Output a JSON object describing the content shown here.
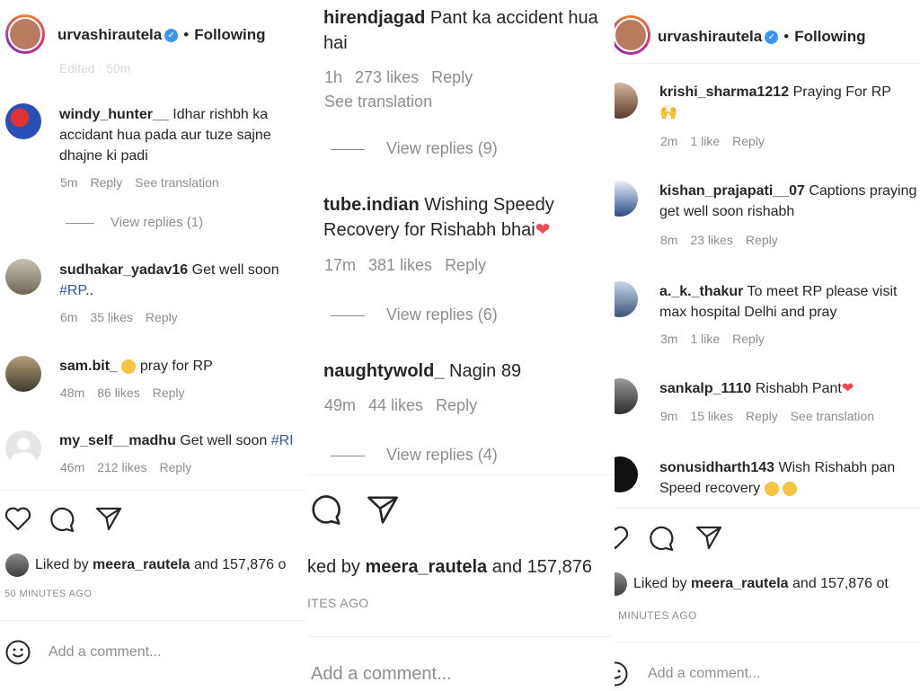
{
  "left": {
    "header": {
      "username": "urvashirautela",
      "following": "Following",
      "verified": "✓"
    },
    "truncated_top": "Edited · 50m",
    "comments": [
      {
        "user": "windy_hunter__",
        "text": "Idhar rishbh ka accidant hua pada aur tuze sajne dhajne ki padi",
        "time": "5m",
        "reply": "Reply",
        "extra": "See translation"
      },
      {
        "user": "sudhakar_yadav16",
        "text": "Get well soon",
        "tag": "#RP",
        "tail": "..",
        "time": "6m",
        "likes": "35 likes",
        "reply": "Reply"
      },
      {
        "user": "sam.bit_",
        "text": "pray for RP",
        "time": "48m",
        "likes": "86 likes",
        "reply": "Reply"
      },
      {
        "user": "my_self__madhu",
        "text": "Get well soon",
        "tag": "#RI",
        "time": "46m",
        "likes": "212 likes",
        "reply": "Reply"
      }
    ],
    "view_replies": "View replies (1)",
    "liked_prefix": "Liked by",
    "liked_user": "meera_rautela",
    "liked_suffix": "and 157,876 o",
    "time_ago": "50 MINUTES AGO",
    "add_comment": "Add a comment..."
  },
  "middle": {
    "comments": [
      {
        "user": "hirendjagad",
        "text": "Pant ka accident hua hai",
        "time": "1h",
        "likes": "273 likes",
        "reply": "Reply",
        "extra": "See translation",
        "replies": "View replies (9)"
      },
      {
        "user": "tube.indian",
        "text": "Wishing Speedy Recovery for Rishabh bhai",
        "time": "17m",
        "likes": "381 likes",
        "reply": "Reply",
        "replies": "View replies (6)"
      },
      {
        "user": "naughtywold_",
        "text": "Nagin 89",
        "time": "49m",
        "likes": "44 likes",
        "reply": "Reply",
        "replies": "View replies (4)"
      }
    ],
    "liked_prefix": "ked by",
    "liked_user": "meera_rautela",
    "liked_suffix": "and 157,876",
    "time_ago": "ITES AGO",
    "add_comment": "Add a comment..."
  },
  "right": {
    "header": {
      "username": "urvashirautela",
      "following": "Following",
      "verified": "✓"
    },
    "comments": [
      {
        "user": "krishi_sharma1212",
        "text": "Praying For RP",
        "time": "2m",
        "likes": "1 like",
        "reply": "Reply"
      },
      {
        "user": "kishan_prajapati__07",
        "text": "Captions praying get well soon rishabh",
        "time": "8m",
        "likes": "23 likes",
        "reply": "Reply"
      },
      {
        "user": "a._k._thakur",
        "text": "To meet RP please visit max hospital Delhi and pray",
        "time": "3m",
        "likes": "1 like",
        "reply": "Reply"
      },
      {
        "user": "sankalp_1110",
        "text": "Rishabh Pant",
        "time": "9m",
        "likes": "15 likes",
        "reply": "Reply",
        "extra": "See translation"
      },
      {
        "user": "sonusidharth143",
        "text": "Wish Rishabh pan Speed recovery"
      }
    ],
    "liked_prefix": "Liked by",
    "liked_user": "meera_rautela",
    "liked_suffix": "and 157,876 ot",
    "time_ago": "MINUTES AGO",
    "add_comment": "Add a comment..."
  },
  "colors": {
    "accent_blue": "#3897f0",
    "heart_red": "#ed4956",
    "muted": "#8e8e8e"
  }
}
